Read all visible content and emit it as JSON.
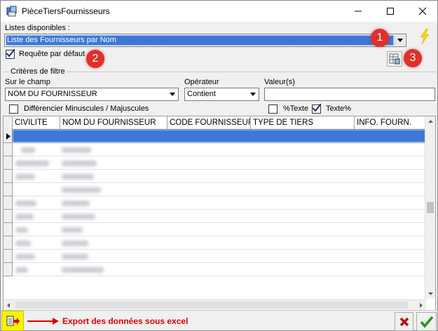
{
  "window": {
    "title": "PièceTiersFournisseurs"
  },
  "top": {
    "lists_label": "Listes disponibles :",
    "lists_value": "Liste des Fournisseurs par Nom",
    "default_query_label": "Requête par défaut",
    "default_query_checked": true
  },
  "badges": [
    "1",
    "2",
    "3"
  ],
  "filter": {
    "group_label": "Critères de filtre",
    "field_label": "Sur le champ",
    "field_value": "NOM DU FOURNISSEUR",
    "operator_label": "Opérateur",
    "operator_value": "Contient",
    "values_label": "Valeur(s)",
    "values_value": "",
    "case_label": "Différencier Minuscules / Majuscules",
    "case_checked": false,
    "pct_text_label": "%Texte",
    "pct_text_checked": false,
    "text_pct_label": "Texte%",
    "text_pct_checked": true
  },
  "grid": {
    "columns": [
      "CIVILITE",
      "NOM DU FOURNISSEUR",
      "CODE FOURNISSEUR",
      "TYPE DE TIERS",
      "INFO. FOURN."
    ]
  },
  "footer": {
    "export_text": "Export des données sous excel"
  },
  "colors": {
    "badge": "#e0302b",
    "selection": "#3d78d8",
    "export_text": "#e00000",
    "ok_green": "#1a9a1a",
    "cancel_red": "#b01818",
    "lightning": "#f5d800"
  }
}
